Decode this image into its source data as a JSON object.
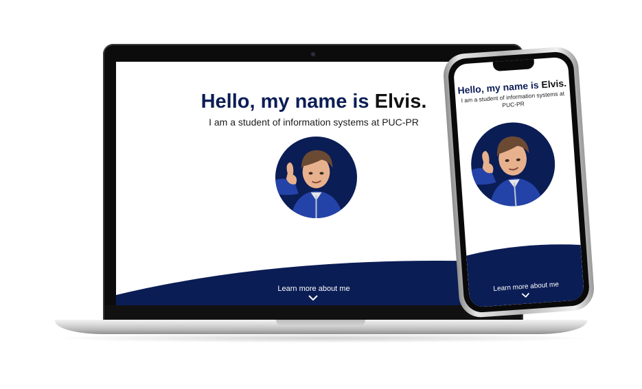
{
  "site": {
    "greeting_prefix": "Hello, my name is ",
    "name": "Elvis.",
    "subtitle": "I am a student of information systems at PUC-PR",
    "cta_label": "Learn more about me",
    "cta_icon": "chevron-down-icon",
    "avatar_icon": "memoji-avatar-icon"
  },
  "mobile": {
    "subtitle_line1": "I am a student of information systems at",
    "subtitle_line2": "PUC-PR"
  },
  "colors": {
    "navy": "#0b1d55",
    "text": "#1c1c1c",
    "background": "#ffffff"
  }
}
